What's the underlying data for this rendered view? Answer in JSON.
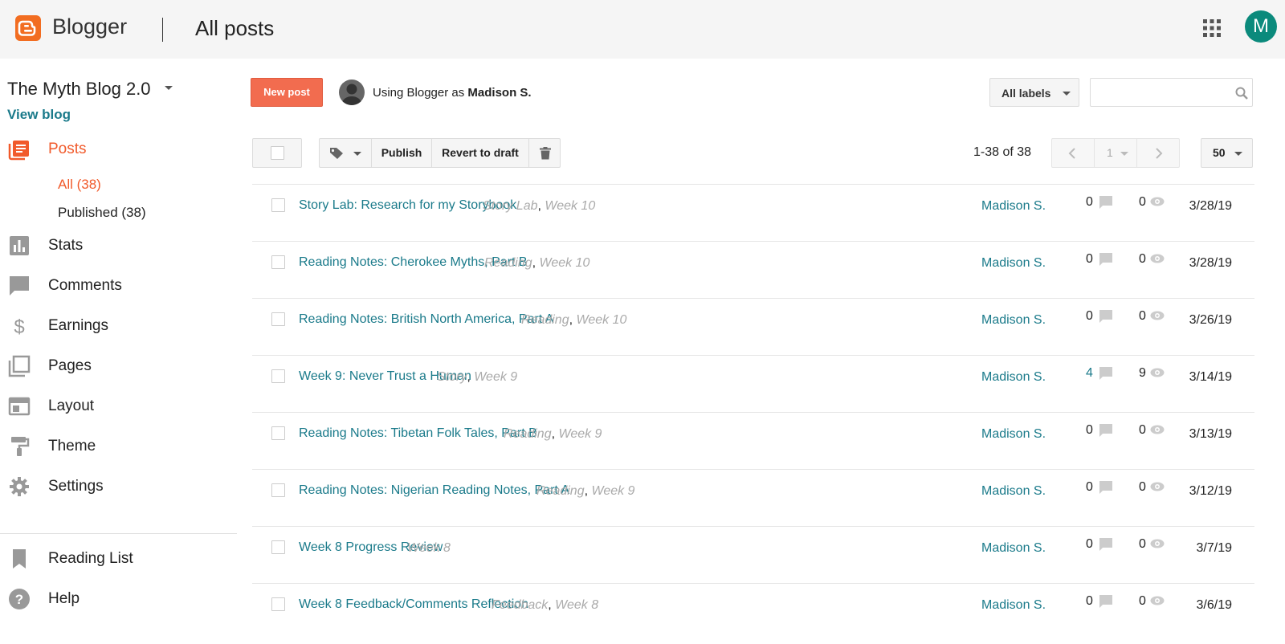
{
  "header": {
    "brand": "Blogger",
    "page_title": "All posts",
    "avatar_letter": "M",
    "accent_color": "#f26d21"
  },
  "sidebar": {
    "blog_name": "The Myth Blog 2.0",
    "view_blog": "View blog",
    "posts_label": "Posts",
    "sub_all": "All (38)",
    "sub_published": "Published (38)",
    "items": [
      {
        "label": "Stats",
        "icon": "stats-icon"
      },
      {
        "label": "Comments",
        "icon": "comment-icon"
      },
      {
        "label": "Earnings",
        "icon": "dollar-icon"
      },
      {
        "label": "Pages",
        "icon": "pages-icon"
      },
      {
        "label": "Layout",
        "icon": "layout-icon"
      },
      {
        "label": "Theme",
        "icon": "paint-roller-icon"
      },
      {
        "label": "Settings",
        "icon": "gear-icon"
      }
    ],
    "reading_list": "Reading List",
    "help": "Help"
  },
  "toolbar": {
    "new_post": "New post",
    "using_prefix": "Using Blogger as",
    "user_name": "Madison S.",
    "all_labels": "All labels",
    "search_placeholder": "",
    "publish": "Publish",
    "revert": "Revert to draft",
    "range": "1-38 of 38",
    "page": "1",
    "per_page": "50"
  },
  "posts": [
    {
      "title": "Story Lab: Research for my Storybook",
      "label1": "Story Lab",
      "label2": "Week 10",
      "author": "Madison S.",
      "comments": "0",
      "views": "0",
      "date": "3/28/19"
    },
    {
      "title": "Reading Notes: Cherokee Myths, Part B",
      "label1": "Reading",
      "label2": "Week 10",
      "author": "Madison S.",
      "comments": "0",
      "views": "0",
      "date": "3/28/19"
    },
    {
      "title": "Reading Notes: British North America, Part A",
      "label1": "Reading",
      "label2": "Week 10",
      "author": "Madison S.",
      "comments": "0",
      "views": "0",
      "date": "3/26/19"
    },
    {
      "title": "Week 9: Never Trust a Human",
      "label1": "Story",
      "label2": "Week 9",
      "author": "Madison S.",
      "comments": "4",
      "views": "9",
      "date": "3/14/19"
    },
    {
      "title": "Reading Notes: Tibetan Folk Tales, Part B",
      "label1": "Reading",
      "label2": "Week 9",
      "author": "Madison S.",
      "comments": "0",
      "views": "0",
      "date": "3/13/19"
    },
    {
      "title": "Reading Notes: Nigerian Reading Notes, Part A",
      "label1": "Reading",
      "label2": "Week 9",
      "author": "Madison S.",
      "comments": "0",
      "views": "0",
      "date": "3/12/19"
    },
    {
      "title": "Week 8 Progress Review",
      "label1": "Week 8",
      "label2": "",
      "author": "Madison S.",
      "comments": "0",
      "views": "0",
      "date": "3/7/19"
    },
    {
      "title": "Week 8 Feedback/Comments Reflection",
      "label1": "Feedback",
      "label2": "Week 8",
      "author": "Madison S.",
      "comments": "0",
      "views": "0",
      "date": "3/6/19"
    }
  ]
}
